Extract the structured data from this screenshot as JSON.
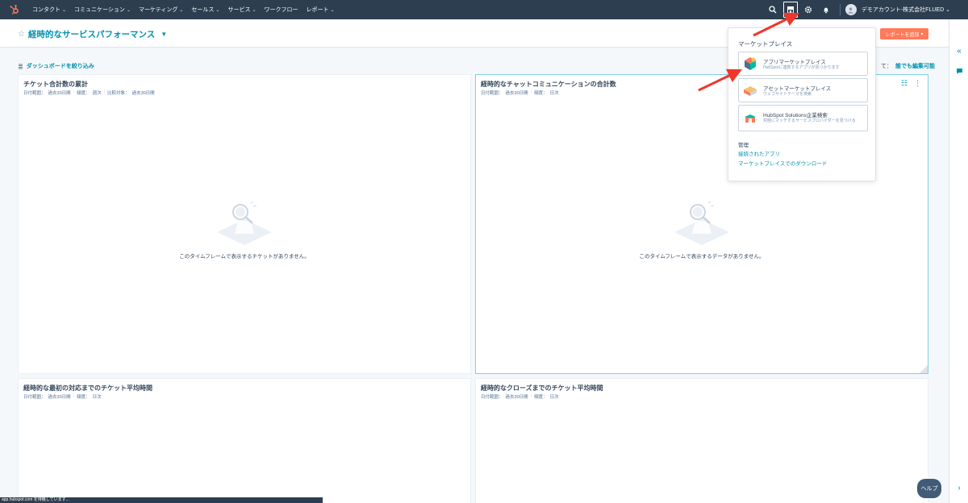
{
  "nav": {
    "items": [
      {
        "label": "コンタクト"
      },
      {
        "label": "コミュニケーション"
      },
      {
        "label": "マーケティング"
      },
      {
        "label": "セールス"
      },
      {
        "label": "サービス"
      },
      {
        "label": "ワークフロー",
        "no_chevron": true
      },
      {
        "label": "レポート"
      }
    ],
    "account": "デモアカウント-株式会社FLUED"
  },
  "header": {
    "title": "経時的なサービスパフォーマンス",
    "add_report": "レポートを追加"
  },
  "filter": {
    "label": "ダッシュボードを絞り込み",
    "edit_prefix": "て：",
    "edit_link": "誰でも編集可能"
  },
  "cards": [
    {
      "title": "チケット合計数の累計",
      "meta": [
        "日付範囲：",
        "過去30日間",
        "|",
        "頻度：",
        "週次",
        "|",
        "比較対象：",
        "過去30日間"
      ],
      "empty": "このタイムフレームで表示するチケットがありません。"
    },
    {
      "title": "経時的なチャットコミュニケーションの合計数",
      "meta": [
        "日付範囲：",
        "過去30日間",
        "|",
        "頻度：",
        "日次"
      ],
      "empty": "このタイムフレームで表示するデータがありません。"
    },
    {
      "title": "経時的な最初の対応までのチケット平均時間",
      "meta": [
        "日付範囲：",
        "過去30日間",
        "|",
        "頻度：",
        "日次"
      ]
    },
    {
      "title": "経時的なクローズまでのチケット平均時間",
      "meta": [
        "日付範囲：",
        "過去30日間",
        "|",
        "頻度：",
        "日次"
      ]
    }
  ],
  "dropdown": {
    "heading": "マーケットプレイス",
    "items": [
      {
        "title": "アプリマーケットプレイス",
        "desc": "HubSpotに連携するアプリが見つかります",
        "icon": "app-marketplace-icon"
      },
      {
        "title": "アセットマーケットプレイス",
        "desc": "ウェブサイトテーマを検索",
        "icon": "asset-marketplace-icon"
      },
      {
        "title": "HubSpot Solutions企業検索",
        "desc": "究極にマッチするサービスプロバイダーを見つける",
        "icon": "solutions-directory-icon"
      }
    ],
    "manage": "管理",
    "links": [
      "接続されたアプリ",
      "マーケットプレイスでのダウンロード"
    ]
  },
  "help": "ヘルプ",
  "status": "app.hubspot.com を待機しています...",
  "colors": {
    "nav_bg": "#2d3e50",
    "accent": "#ff7a59",
    "link": "#0091ae",
    "arrow": "#f0362c"
  }
}
